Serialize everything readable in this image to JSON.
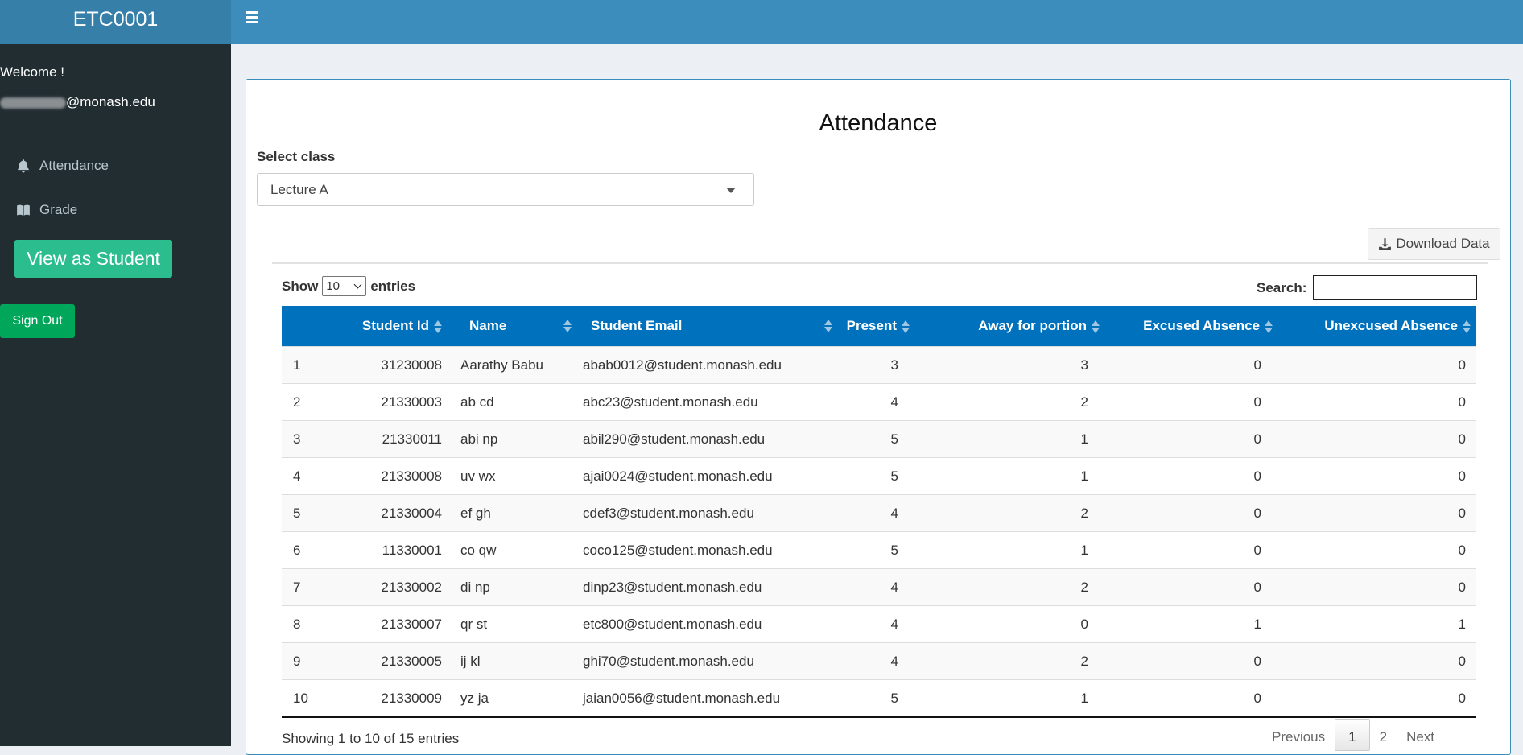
{
  "app": {
    "title": "ETC0001"
  },
  "sidebar": {
    "welcome": "Welcome !",
    "email_visible": "@monash.edu",
    "items": [
      {
        "label": "Attendance",
        "icon": "bell-icon"
      },
      {
        "label": "Grade",
        "icon": "book-icon"
      }
    ],
    "view_as_student": "View as Student",
    "sign_out": "Sign Out"
  },
  "main": {
    "title": "Attendance",
    "select_label": "Select class",
    "selected_class": "Lecture A",
    "download_label": "Download Data",
    "show_label": "Show",
    "entries_value": "10",
    "entries_label": "entries",
    "search_label": "Search:",
    "search_value": "",
    "columns": [
      "Student Id",
      "Name",
      "Student Email",
      "Present",
      "Away for portion",
      "Excused Absence",
      "Unexcused Absence"
    ],
    "rows": [
      {
        "n": "1",
        "id": "31230008",
        "name": "Aarathy Babu",
        "email": "abab0012@student.monash.edu",
        "present": "3",
        "away": "3",
        "excused": "0",
        "unexcused": "0"
      },
      {
        "n": "2",
        "id": "21330003",
        "name": "ab cd",
        "email": "abc23@student.monash.edu",
        "present": "4",
        "away": "2",
        "excused": "0",
        "unexcused": "0"
      },
      {
        "n": "3",
        "id": "21330011",
        "name": "abi np",
        "email": "abil290@student.monash.edu",
        "present": "5",
        "away": "1",
        "excused": "0",
        "unexcused": "0"
      },
      {
        "n": "4",
        "id": "21330008",
        "name": "uv wx",
        "email": "ajai0024@student.monash.edu",
        "present": "5",
        "away": "1",
        "excused": "0",
        "unexcused": "0"
      },
      {
        "n": "5",
        "id": "21330004",
        "name": "ef gh",
        "email": "cdef3@student.monash.edu",
        "present": "4",
        "away": "2",
        "excused": "0",
        "unexcused": "0"
      },
      {
        "n": "6",
        "id": "11330001",
        "name": "co qw",
        "email": "coco125@student.monash.edu",
        "present": "5",
        "away": "1",
        "excused": "0",
        "unexcused": "0"
      },
      {
        "n": "7",
        "id": "21330002",
        "name": "di np",
        "email": "dinp23@student.monash.edu",
        "present": "4",
        "away": "2",
        "excused": "0",
        "unexcused": "0"
      },
      {
        "n": "8",
        "id": "21330007",
        "name": "qr st",
        "email": "etc800@student.monash.edu",
        "present": "4",
        "away": "0",
        "excused": "1",
        "unexcused": "1"
      },
      {
        "n": "9",
        "id": "21330005",
        "name": "ij kl",
        "email": "ghi70@student.monash.edu",
        "present": "4",
        "away": "2",
        "excused": "0",
        "unexcused": "0"
      },
      {
        "n": "10",
        "id": "21330009",
        "name": "yz ja",
        "email": "jaian0056@student.monash.edu",
        "present": "5",
        "away": "1",
        "excused": "0",
        "unexcused": "0"
      }
    ],
    "info": "Showing 1 to 10 of 15 entries",
    "pagination": {
      "previous": "Previous",
      "pages": [
        "1",
        "2"
      ],
      "current": "1",
      "next": "Next"
    }
  },
  "colors": {
    "header": "#3c8dbc",
    "sidebar": "#222d32",
    "table_header": "#0072bd",
    "student_button": "#2bbd8e",
    "signout_button": "#00a65a"
  }
}
